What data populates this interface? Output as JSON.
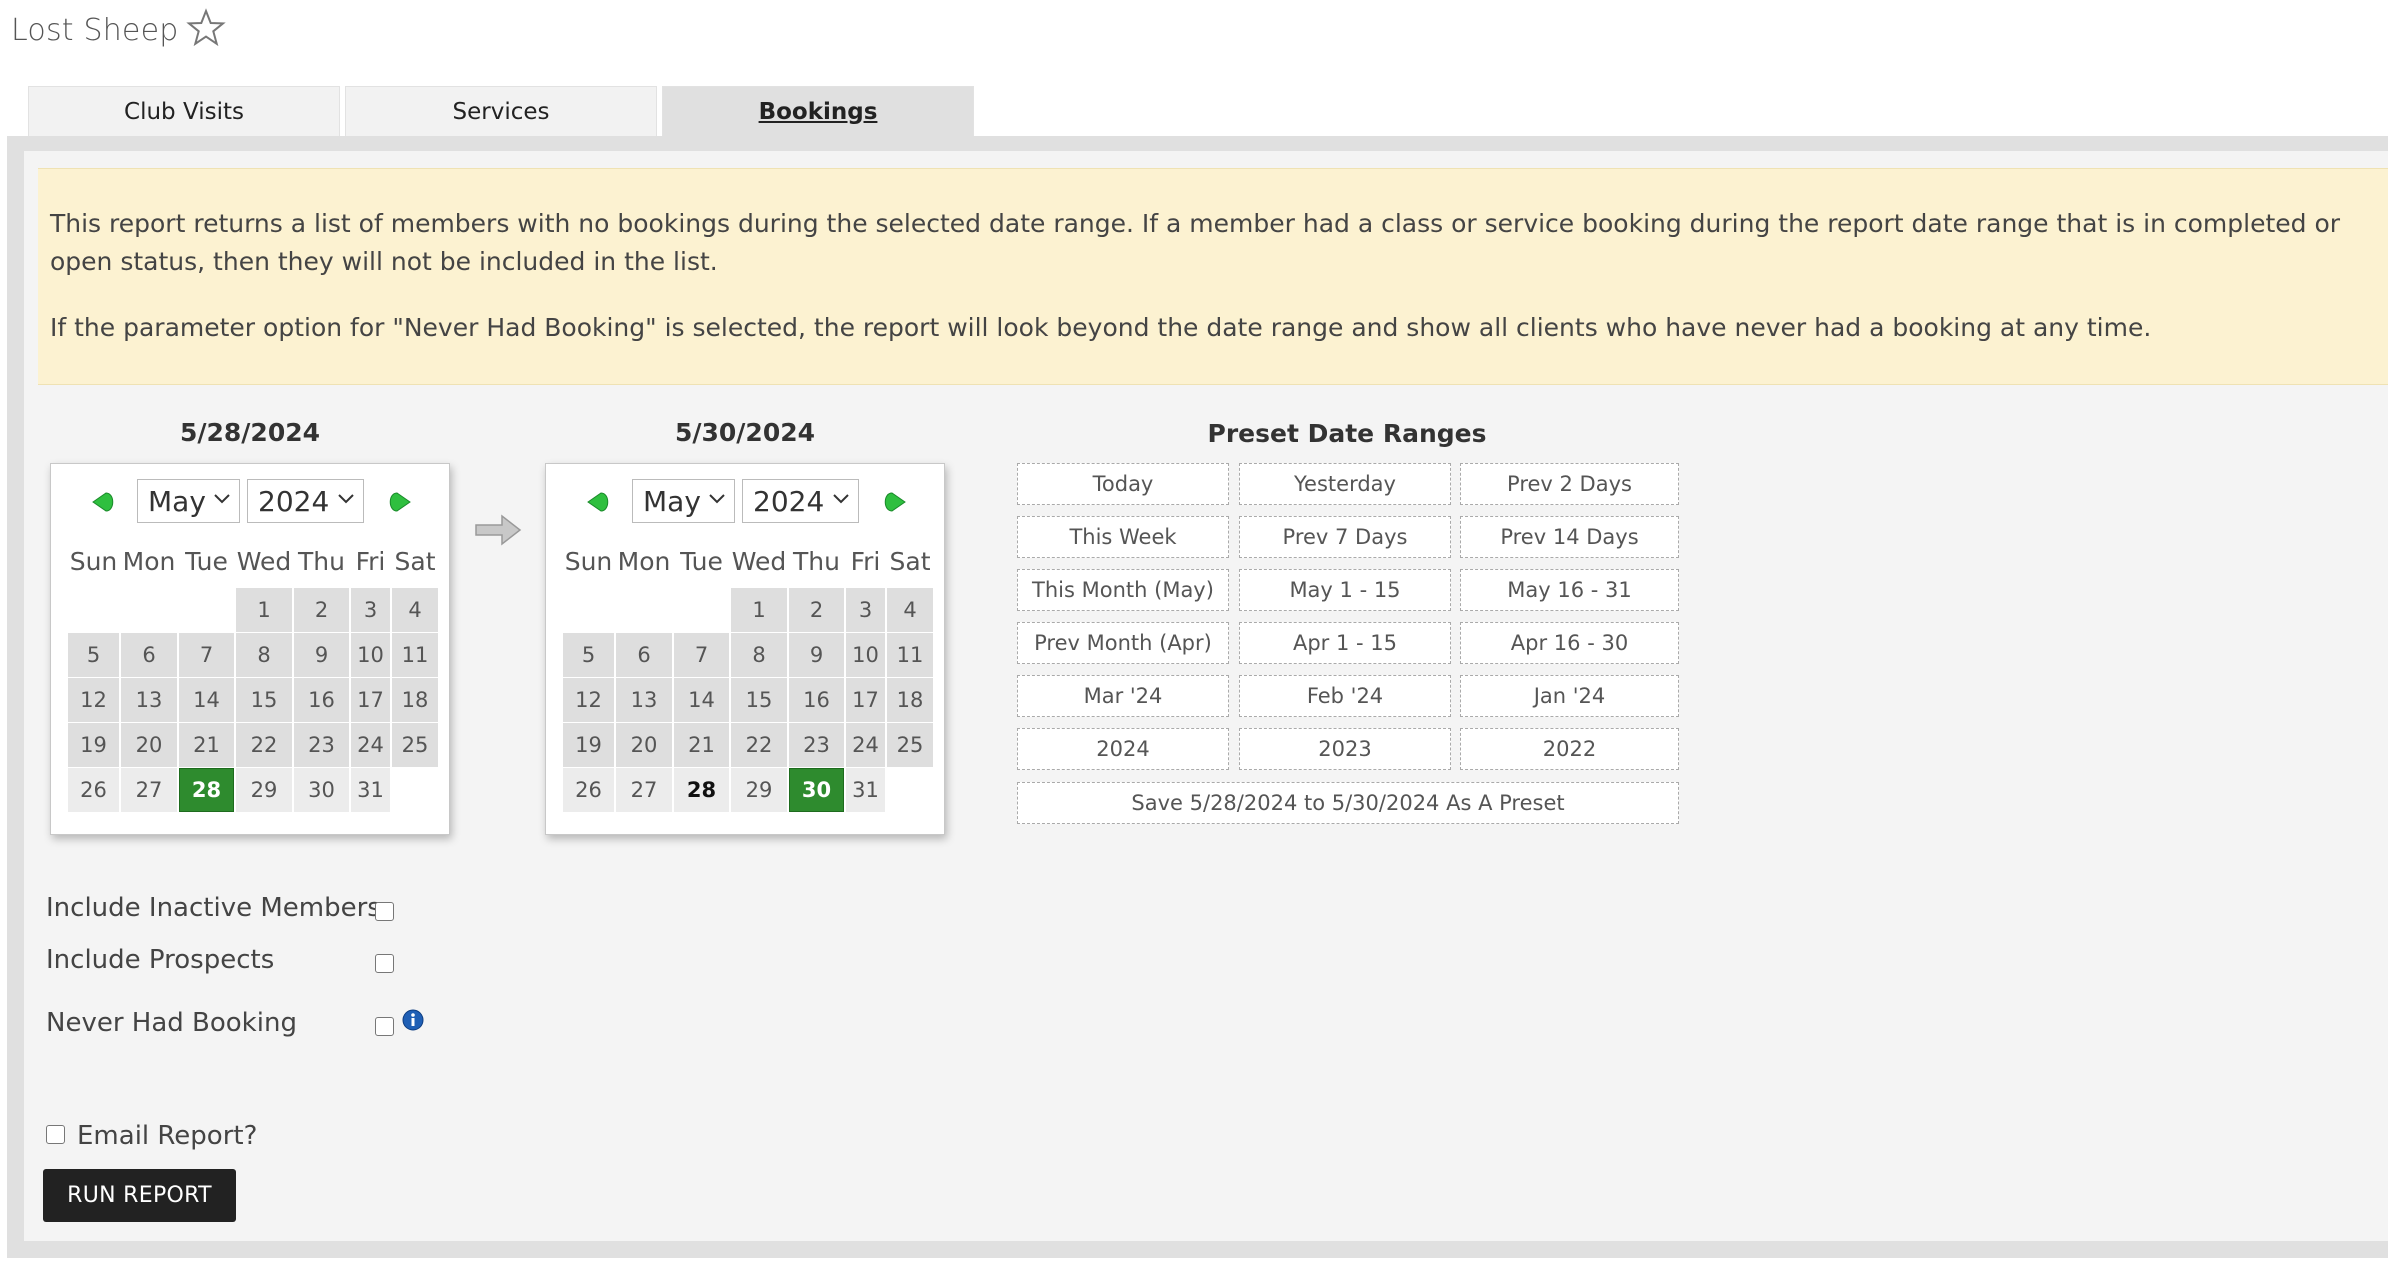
{
  "app": {
    "title": "Lost Sheep"
  },
  "tabs": [
    {
      "label": "Club Visits",
      "active": false
    },
    {
      "label": "Services",
      "active": false
    },
    {
      "label": "Bookings",
      "active": true
    }
  ],
  "note": {
    "paragraph1": "This report returns a list of members with no bookings during the selected date range. If a member had a class or service booking during the report date range that is in completed or open status, then they will not be included in the list.",
    "paragraph2": "If the parameter option for \"Never Had Booking\" is selected, the report will look beyond the date range and show all clients who have never had a booking at any time."
  },
  "start_calendar": {
    "label": "5/28/2024",
    "month": "May",
    "year": "2024",
    "selected_day": 28
  },
  "end_calendar": {
    "label": "5/30/2024",
    "month": "May",
    "year": "2024",
    "selected_day": 30,
    "highlight_day": 28
  },
  "weekdays": [
    "Sun",
    "Mon",
    "Tue",
    "Wed",
    "Thu",
    "Fri",
    "Sat"
  ],
  "month_days": 31,
  "month_start_weekday": 3,
  "presets": {
    "title": "Preset Date Ranges",
    "rows": [
      [
        "Today",
        "Yesterday",
        "Prev 2 Days"
      ],
      [
        "This Week",
        "Prev 7 Days",
        "Prev 14 Days"
      ],
      [
        "This Month (May)",
        "May 1 - 15",
        "May 16 - 31"
      ],
      [
        "Prev Month (Apr)",
        "Apr 1 - 15",
        "Apr 16 - 30"
      ],
      [
        "Mar '24",
        "Feb '24",
        "Jan '24"
      ],
      [
        "2024",
        "2023",
        "2022"
      ]
    ],
    "save_label": "Save 5/28/2024 to 5/30/2024 As A Preset"
  },
  "options": {
    "include_inactive": "Include Inactive Members",
    "include_prospects": "Include Prospects",
    "never_had_booking": "Never Had Booking"
  },
  "email_label": "Email Report?",
  "run_label": "RUN REPORT",
  "colors": {
    "accent_green": "#2e8b2e",
    "note_bg": "#fcf2d1",
    "button_dark": "#222222"
  }
}
